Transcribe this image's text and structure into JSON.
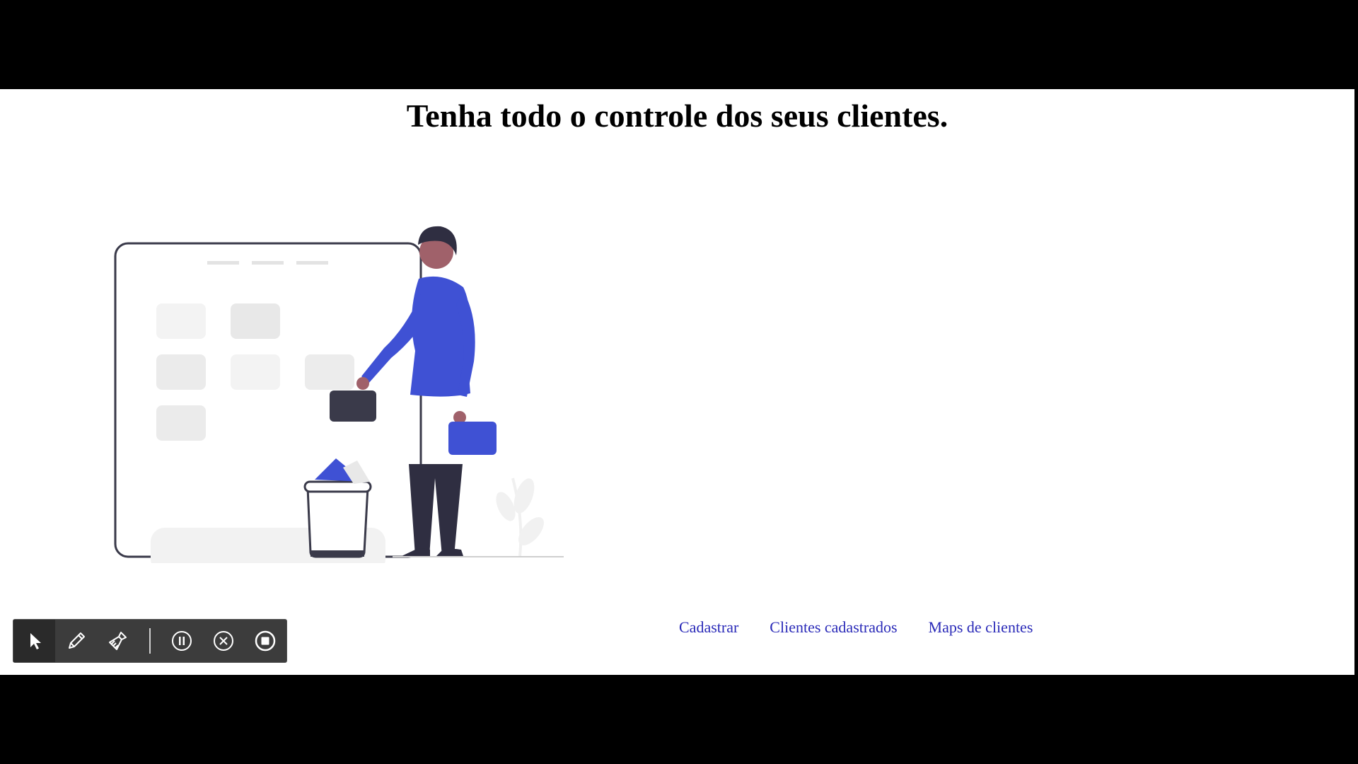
{
  "page": {
    "title": "Tenha todo o controle dos seus clientes."
  },
  "nav": {
    "links": [
      {
        "label": "Cadastrar"
      },
      {
        "label": "Clientes cadastrados"
      },
      {
        "label": "Maps de clientes"
      }
    ],
    "link_color": "#2a2ab8"
  },
  "illustration": {
    "subject": "person-deleting-items-illustration",
    "accent_color": "#3f51d4",
    "dark_color": "#3a3a4a"
  },
  "toolbar": {
    "tools": [
      {
        "icon": "cursor-icon",
        "state": "active"
      },
      {
        "icon": "pencil-icon"
      },
      {
        "icon": "brush-icon"
      },
      {
        "icon": "pause-icon"
      },
      {
        "icon": "cancel-icon"
      },
      {
        "icon": "stop-icon"
      }
    ],
    "background": "#3c3c3c"
  }
}
